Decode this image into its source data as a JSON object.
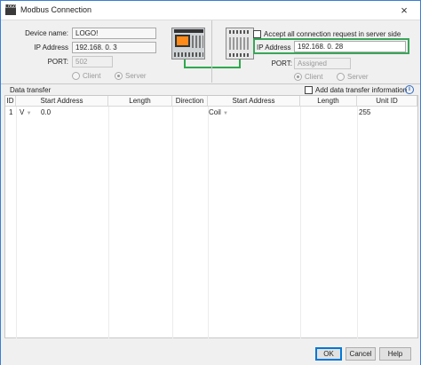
{
  "window": {
    "title": "Modbus Connection",
    "icon_text": "LOGO",
    "close_glyph": "×"
  },
  "local": {
    "device_name_label": "Device name:",
    "device_name_value": "LOGO!",
    "ip_label": "IP Address",
    "ip_value": "192.168.  0.  3",
    "port_label": "PORT:",
    "port_value": "502",
    "client_label": "Client",
    "server_label": "Server",
    "selected_mode": "Server"
  },
  "remote": {
    "accept_all_label": "Accept all connection request in server side",
    "accept_all_checked": false,
    "ip_label": "IP Address",
    "ip_value": "192.168.  0. 28",
    "port_label": "PORT:",
    "port_value": "Assigned",
    "client_label": "Client",
    "server_label": "Server",
    "selected_mode": "Client"
  },
  "data_transfer": {
    "section_label": "Data transfer",
    "add_info_label": "Add data transfer information",
    "add_info_checked": false,
    "columns": [
      "ID",
      "Start Address",
      "Length",
      "Direction",
      "Start Address",
      "Length",
      "Unit ID"
    ],
    "rows": [
      {
        "id": "1",
        "local_type": "V",
        "local_address": "0.0",
        "length": "",
        "direction": "",
        "remote_type": "Coil",
        "remote_address": "",
        "remote_length": "",
        "unit_id": "255"
      }
    ]
  },
  "footer": {
    "ok_label": "OK",
    "cancel_label": "Cancel",
    "help_label": "Help"
  },
  "colors": {
    "highlight": "#3aa55a",
    "connector": "#2fa84f",
    "logo_screen": "#ff8a1a",
    "window_border": "#3a7fd6"
  }
}
